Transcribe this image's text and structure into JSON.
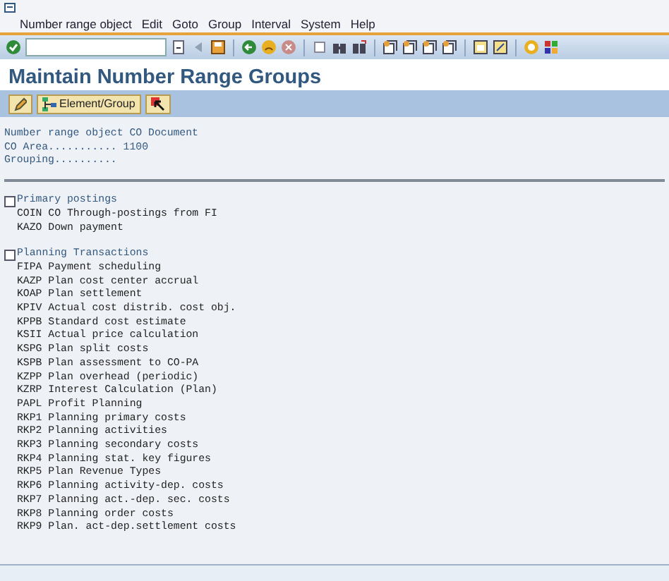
{
  "menu_bar": [
    "Number range object",
    "Edit",
    "Goto",
    "Group",
    "Interval",
    "System",
    "Help"
  ],
  "title": "Maintain Number Range Groups",
  "app_toolbar": [
    {
      "kind": "icon"
    },
    {
      "kind": "labeled",
      "label": "Element/Group"
    },
    {
      "kind": "icon2"
    }
  ],
  "header": [
    "Number range object CO Document",
    "CO Area........... 1100",
    "Grouping.........."
  ],
  "groups": [
    {
      "title": "Primary postings",
      "checked": false,
      "items": [
        "COIN CO Through-postings from FI",
        "KAZO Down payment"
      ]
    },
    {
      "title": "Planning Transactions",
      "checked": false,
      "items": [
        "FIPA Payment scheduling",
        "KAZP Plan cost center accrual",
        "KOAP Plan settlement",
        "KPIV Actual cost distrib. cost obj.",
        "KPPB Standard cost estimate",
        "KSII Actual price calculation",
        "KSPG Plan split costs",
        "KSPB Plan assessment to CO-PA",
        "KZPP Plan overhead (periodic)",
        "KZRP Interest Calculation (Plan)",
        "PAPL Profit Planning",
        "RKP1 Planning primary costs",
        "RKP2 Planning activities",
        "RKP3 Planning secondary costs",
        "RKP4 Planning stat. key figures",
        "RKP5 Plan Revenue Types",
        "RKP6 Planning activity-dep. costs",
        "RKP7 Planning act.-dep. sec. costs",
        "RKP8 Planning order costs",
        "RKP9 Plan. act-dep.settlement costs"
      ]
    }
  ]
}
